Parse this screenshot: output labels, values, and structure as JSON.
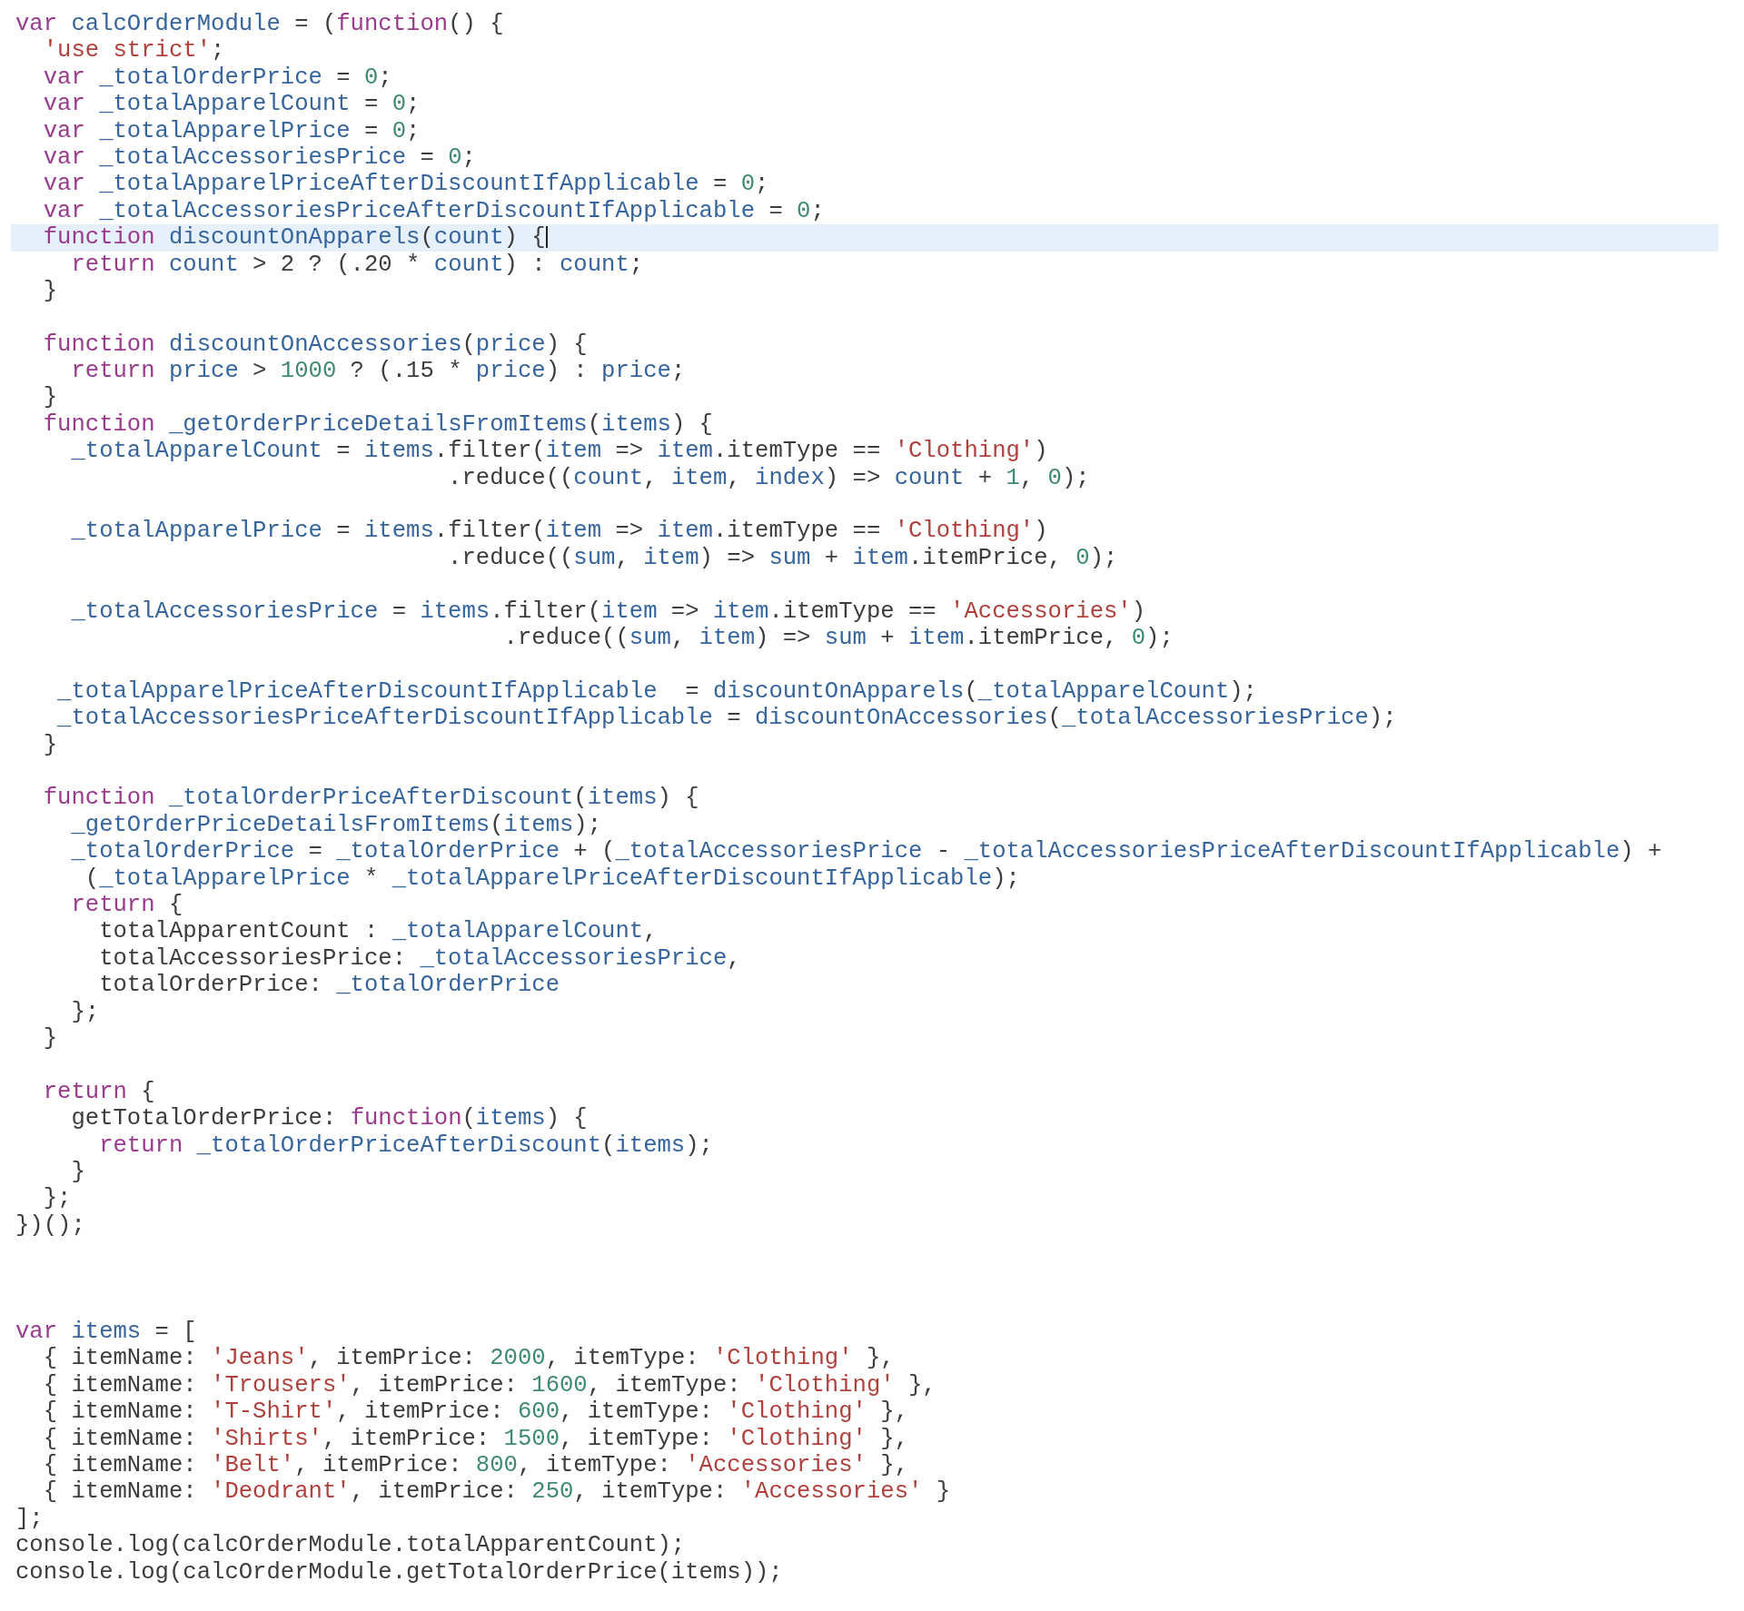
{
  "editor": {
    "module_lines": [
      {
        "current": false,
        "space_before": false,
        "tokens": [
          {
            "kind": "keyword",
            "text": "var"
          },
          {
            "kind": "name",
            "text": " calcOrderModule"
          },
          {
            "kind": "plain",
            "text": " = ("
          },
          {
            "kind": "keyword",
            "text": "function"
          },
          {
            "kind": "plain",
            "text": "() {"
          }
        ]
      },
      {
        "current": false,
        "space_before": false,
        "tokens": [
          {
            "kind": "string",
            "text": "  'use strict'"
          },
          {
            "kind": "plain",
            "text": ";"
          }
        ]
      },
      {
        "current": false,
        "space_before": false,
        "tokens": [
          {
            "kind": "keyword",
            "text": "  var"
          },
          {
            "kind": "name",
            "text": " _totalOrderPrice"
          },
          {
            "kind": "plain",
            "text": " = "
          },
          {
            "kind": "number",
            "text": "0"
          },
          {
            "kind": "plain",
            "text": ";"
          }
        ]
      },
      {
        "current": false,
        "space_before": false,
        "tokens": [
          {
            "kind": "keyword",
            "text": "  var"
          },
          {
            "kind": "name",
            "text": " _totalApparelCount"
          },
          {
            "kind": "plain",
            "text": " = "
          },
          {
            "kind": "number",
            "text": "0"
          },
          {
            "kind": "plain",
            "text": ";"
          }
        ]
      },
      {
        "current": false,
        "space_before": false,
        "tokens": [
          {
            "kind": "keyword",
            "text": "  var"
          },
          {
            "kind": "name",
            "text": " _totalApparelPrice"
          },
          {
            "kind": "plain",
            "text": " = "
          },
          {
            "kind": "number",
            "text": "0"
          },
          {
            "kind": "plain",
            "text": ";"
          }
        ]
      },
      {
        "current": false,
        "space_before": false,
        "tokens": [
          {
            "kind": "keyword",
            "text": "  var"
          },
          {
            "kind": "name",
            "text": " _totalAccessoriesPrice"
          },
          {
            "kind": "plain",
            "text": " = "
          },
          {
            "kind": "number",
            "text": "0"
          },
          {
            "kind": "plain",
            "text": ";"
          }
        ]
      },
      {
        "current": false,
        "space_before": false,
        "tokens": [
          {
            "kind": "keyword",
            "text": "  var"
          },
          {
            "kind": "name",
            "text": " _totalApparelPriceAfterDiscountIfApplicable"
          },
          {
            "kind": "plain",
            "text": " = "
          },
          {
            "kind": "number",
            "text": "0"
          },
          {
            "kind": "plain",
            "text": ";"
          }
        ]
      },
      {
        "current": false,
        "space_before": false,
        "tokens": [
          {
            "kind": "keyword",
            "text": "  var"
          },
          {
            "kind": "name",
            "text": " _totalAccessoriesPriceAfterDiscountIfApplicable"
          },
          {
            "kind": "plain",
            "text": " = "
          },
          {
            "kind": "number",
            "text": "0"
          },
          {
            "kind": "plain",
            "text": ";"
          }
        ]
      },
      {
        "current": true,
        "space_before": false,
        "tokens": [
          {
            "kind": "keyword",
            "text": "  function"
          },
          {
            "kind": "name",
            "text": " discountOnApparels"
          },
          {
            "kind": "plain",
            "text": "("
          },
          {
            "kind": "name",
            "text": "count"
          },
          {
            "kind": "plain",
            "text": ") {"
          }
        ]
      },
      {
        "current": false,
        "space_before": false,
        "tokens": [
          {
            "kind": "keyword",
            "text": "    return"
          },
          {
            "kind": "name",
            "text": " count"
          },
          {
            "kind": "plain",
            "text": " > 2 ? (.20 * "
          },
          {
            "kind": "name",
            "text": "count"
          },
          {
            "kind": "plain",
            "text": ") : "
          },
          {
            "kind": "name",
            "text": "count"
          },
          {
            "kind": "plain",
            "text": ";"
          }
        ]
      },
      {
        "current": false,
        "space_before": false,
        "tokens": [
          {
            "kind": "plain",
            "text": "  }"
          }
        ]
      },
      {
        "current": false,
        "space_before": true,
        "tokens": [
          {
            "kind": "keyword",
            "text": "  function"
          },
          {
            "kind": "name",
            "text": " discountOnAccessories"
          },
          {
            "kind": "plain",
            "text": "("
          },
          {
            "kind": "name",
            "text": "price"
          },
          {
            "kind": "plain",
            "text": ") {"
          }
        ]
      },
      {
        "current": false,
        "space_before": false,
        "tokens": [
          {
            "kind": "keyword",
            "text": "    return"
          },
          {
            "kind": "name",
            "text": " price"
          },
          {
            "kind": "plain",
            "text": " > "
          },
          {
            "kind": "number",
            "text": "1000"
          },
          {
            "kind": "plain",
            "text": " ? (.15 * "
          },
          {
            "kind": "name",
            "text": "price"
          },
          {
            "kind": "plain",
            "text": ") : "
          },
          {
            "kind": "name",
            "text": "price"
          },
          {
            "kind": "plain",
            "text": ";"
          }
        ]
      },
      {
        "current": false,
        "space_before": false,
        "tokens": [
          {
            "kind": "plain",
            "text": "  }"
          }
        ]
      },
      {
        "current": false,
        "space_before": false,
        "tokens": [
          {
            "kind": "keyword",
            "text": "  function"
          },
          {
            "kind": "name",
            "text": " _getOrderPriceDetailsFromItems"
          },
          {
            "kind": "plain",
            "text": "("
          },
          {
            "kind": "name",
            "text": "items"
          },
          {
            "kind": "plain",
            "text": ") {"
          }
        ]
      },
      {
        "current": false,
        "space_before": false,
        "tokens": [
          {
            "kind": "name",
            "text": "    _totalApparelCount"
          },
          {
            "kind": "plain",
            "text": " = "
          },
          {
            "kind": "name",
            "text": "items"
          },
          {
            "kind": "plain",
            "text": ".filter("
          },
          {
            "kind": "name",
            "text": "item"
          },
          {
            "kind": "plain",
            "text": " => "
          },
          {
            "kind": "name",
            "text": "item"
          },
          {
            "kind": "plain",
            "text": ".itemType == "
          },
          {
            "kind": "string",
            "text": "'Clothing'"
          },
          {
            "kind": "plain",
            "text": ")"
          }
        ]
      },
      {
        "current": false,
        "space_before": false,
        "tokens": [
          {
            "kind": "plain",
            "text": "                               .reduce(("
          },
          {
            "kind": "name",
            "text": "count"
          },
          {
            "kind": "plain",
            "text": ", "
          },
          {
            "kind": "name",
            "text": "item"
          },
          {
            "kind": "plain",
            "text": ", "
          },
          {
            "kind": "name",
            "text": "index"
          },
          {
            "kind": "plain",
            "text": ") => "
          },
          {
            "kind": "name",
            "text": "count"
          },
          {
            "kind": "plain",
            "text": " + "
          },
          {
            "kind": "number",
            "text": "1"
          },
          {
            "kind": "plain",
            "text": ", "
          },
          {
            "kind": "number",
            "text": "0"
          },
          {
            "kind": "plain",
            "text": ");"
          }
        ]
      },
      {
        "current": false,
        "space_before": true,
        "tokens": [
          {
            "kind": "name",
            "text": "    _totalApparelPrice"
          },
          {
            "kind": "plain",
            "text": " = "
          },
          {
            "kind": "name",
            "text": "items"
          },
          {
            "kind": "plain",
            "text": ".filter("
          },
          {
            "kind": "name",
            "text": "item"
          },
          {
            "kind": "plain",
            "text": " => "
          },
          {
            "kind": "name",
            "text": "item"
          },
          {
            "kind": "plain",
            "text": ".itemType == "
          },
          {
            "kind": "string",
            "text": "'Clothing'"
          },
          {
            "kind": "plain",
            "text": ")"
          }
        ]
      },
      {
        "current": false,
        "space_before": false,
        "tokens": [
          {
            "kind": "plain",
            "text": "                               .reduce(("
          },
          {
            "kind": "name",
            "text": "sum"
          },
          {
            "kind": "plain",
            "text": ", "
          },
          {
            "kind": "name",
            "text": "item"
          },
          {
            "kind": "plain",
            "text": ") => "
          },
          {
            "kind": "name",
            "text": "sum"
          },
          {
            "kind": "plain",
            "text": " + "
          },
          {
            "kind": "name",
            "text": "item"
          },
          {
            "kind": "plain",
            "text": ".itemPrice, "
          },
          {
            "kind": "number",
            "text": "0"
          },
          {
            "kind": "plain",
            "text": ");"
          }
        ]
      },
      {
        "current": false,
        "space_before": true,
        "tokens": [
          {
            "kind": "name",
            "text": "    _totalAccessoriesPrice"
          },
          {
            "kind": "plain",
            "text": " = "
          },
          {
            "kind": "name",
            "text": "items"
          },
          {
            "kind": "plain",
            "text": ".filter("
          },
          {
            "kind": "name",
            "text": "item"
          },
          {
            "kind": "plain",
            "text": " => "
          },
          {
            "kind": "name",
            "text": "item"
          },
          {
            "kind": "plain",
            "text": ".itemType == "
          },
          {
            "kind": "string",
            "text": "'Accessories'"
          },
          {
            "kind": "plain",
            "text": ")"
          }
        ]
      },
      {
        "current": false,
        "space_before": false,
        "tokens": [
          {
            "kind": "plain",
            "text": "                                   .reduce(("
          },
          {
            "kind": "name",
            "text": "sum"
          },
          {
            "kind": "plain",
            "text": ", "
          },
          {
            "kind": "name",
            "text": "item"
          },
          {
            "kind": "plain",
            "text": ") => "
          },
          {
            "kind": "name",
            "text": "sum"
          },
          {
            "kind": "plain",
            "text": " + "
          },
          {
            "kind": "name",
            "text": "item"
          },
          {
            "kind": "plain",
            "text": ".itemPrice, "
          },
          {
            "kind": "number",
            "text": "0"
          },
          {
            "kind": "plain",
            "text": ");"
          }
        ]
      },
      {
        "current": false,
        "space_before": true,
        "tokens": [
          {
            "kind": "name",
            "text": "   _totalApparelPriceAfterDiscountIfApplicable"
          },
          {
            "kind": "plain",
            "text": "  = "
          },
          {
            "kind": "name",
            "text": "discountOnApparels"
          },
          {
            "kind": "plain",
            "text": "("
          },
          {
            "kind": "name",
            "text": "_totalApparelCount"
          },
          {
            "kind": "plain",
            "text": ");"
          }
        ]
      },
      {
        "current": false,
        "space_before": false,
        "tokens": [
          {
            "kind": "name",
            "text": "   _totalAccessoriesPriceAfterDiscountIfApplicable"
          },
          {
            "kind": "plain",
            "text": " = "
          },
          {
            "kind": "name",
            "text": "discountOnAccessories"
          },
          {
            "kind": "plain",
            "text": "("
          },
          {
            "kind": "name",
            "text": "_totalAccessoriesPrice"
          },
          {
            "kind": "plain",
            "text": ");"
          }
        ]
      },
      {
        "current": false,
        "space_before": false,
        "tokens": [
          {
            "kind": "plain",
            "text": "  }"
          }
        ]
      },
      {
        "current": false,
        "space_before": true,
        "tokens": [
          {
            "kind": "keyword",
            "text": "  function"
          },
          {
            "kind": "name",
            "text": " _totalOrderPriceAfterDiscount"
          },
          {
            "kind": "plain",
            "text": "("
          },
          {
            "kind": "name",
            "text": "items"
          },
          {
            "kind": "plain",
            "text": ") {"
          }
        ]
      },
      {
        "current": false,
        "space_before": false,
        "tokens": [
          {
            "kind": "name",
            "text": "    _getOrderPriceDetailsFromItems"
          },
          {
            "kind": "plain",
            "text": "("
          },
          {
            "kind": "name",
            "text": "items"
          },
          {
            "kind": "plain",
            "text": ");"
          }
        ]
      },
      {
        "current": false,
        "space_before": false,
        "tokens": [
          {
            "kind": "name",
            "text": "    _totalOrderPrice"
          },
          {
            "kind": "plain",
            "text": " = "
          },
          {
            "kind": "name",
            "text": "_totalOrderPrice"
          },
          {
            "kind": "plain",
            "text": " + ("
          },
          {
            "kind": "name",
            "text": "_totalAccessoriesPrice"
          },
          {
            "kind": "plain",
            "text": " - "
          },
          {
            "kind": "name",
            "text": "_totalAccessoriesPriceAfterDiscountIfApplicable"
          },
          {
            "kind": "plain",
            "text": ") +"
          }
        ]
      },
      {
        "current": false,
        "space_before": false,
        "tokens": [
          {
            "kind": "plain",
            "text": "     ("
          },
          {
            "kind": "name",
            "text": "_totalApparelPrice"
          },
          {
            "kind": "plain",
            "text": " * "
          },
          {
            "kind": "name",
            "text": "_totalApparelPriceAfterDiscountIfApplicable"
          },
          {
            "kind": "plain",
            "text": ");"
          }
        ]
      },
      {
        "current": false,
        "space_before": false,
        "tokens": [
          {
            "kind": "keyword",
            "text": "    return"
          },
          {
            "kind": "plain",
            "text": " {"
          }
        ]
      },
      {
        "current": false,
        "space_before": false,
        "tokens": [
          {
            "kind": "plain",
            "text": "      totalApparentCount : "
          },
          {
            "kind": "name",
            "text": "_totalApparelCount"
          },
          {
            "kind": "plain",
            "text": ","
          }
        ]
      },
      {
        "current": false,
        "space_before": false,
        "tokens": [
          {
            "kind": "plain",
            "text": "      totalAccessoriesPrice: "
          },
          {
            "kind": "name",
            "text": "_totalAccessoriesPrice"
          },
          {
            "kind": "plain",
            "text": ","
          }
        ]
      },
      {
        "current": false,
        "space_before": false,
        "tokens": [
          {
            "kind": "plain",
            "text": "      totalOrderPrice: "
          },
          {
            "kind": "name",
            "text": "_totalOrderPrice"
          }
        ]
      },
      {
        "current": false,
        "space_before": false,
        "tokens": [
          {
            "kind": "plain",
            "text": "    };"
          }
        ]
      },
      {
        "current": false,
        "space_before": false,
        "tokens": [
          {
            "kind": "plain",
            "text": "  }"
          }
        ]
      },
      {
        "current": false,
        "space_before": true,
        "tokens": [
          {
            "kind": "keyword",
            "text": "  return"
          },
          {
            "kind": "plain",
            "text": " {"
          }
        ]
      },
      {
        "current": false,
        "space_before": false,
        "tokens": [
          {
            "kind": "plain",
            "text": "    getTotalOrderPrice: "
          },
          {
            "kind": "keyword",
            "text": "function"
          },
          {
            "kind": "plain",
            "text": "("
          },
          {
            "kind": "name",
            "text": "items"
          },
          {
            "kind": "plain",
            "text": ") {"
          }
        ]
      },
      {
        "current": false,
        "space_before": false,
        "tokens": [
          {
            "kind": "keyword",
            "text": "      return"
          },
          {
            "kind": "name",
            "text": " _totalOrderPriceAfterDiscount"
          },
          {
            "kind": "plain",
            "text": "("
          },
          {
            "kind": "name",
            "text": "items"
          },
          {
            "kind": "plain",
            "text": ");"
          }
        ]
      },
      {
        "current": false,
        "space_before": false,
        "tokens": [
          {
            "kind": "plain",
            "text": "    }"
          }
        ]
      },
      {
        "current": false,
        "space_before": false,
        "tokens": [
          {
            "kind": "plain",
            "text": "  };"
          }
        ]
      },
      {
        "current": false,
        "space_before": false,
        "tokens": [
          {
            "kind": "plain",
            "text": "})();"
          }
        ]
      }
    ],
    "script_lines": [
      {
        "current": false,
        "space_before": false,
        "tokens": [
          {
            "kind": "keyword",
            "text": "var"
          },
          {
            "kind": "name",
            "text": " items"
          },
          {
            "kind": "plain",
            "text": " = ["
          }
        ]
      },
      {
        "current": false,
        "space_before": false,
        "tokens": [
          {
            "kind": "plain",
            "text": "  { itemName: "
          },
          {
            "kind": "string",
            "text": "'Jeans'"
          },
          {
            "kind": "plain",
            "text": ", itemPrice: "
          },
          {
            "kind": "number",
            "text": "2000"
          },
          {
            "kind": "plain",
            "text": ", itemType: "
          },
          {
            "kind": "string",
            "text": "'Clothing'"
          },
          {
            "kind": "plain",
            "text": " },"
          }
        ]
      },
      {
        "current": false,
        "space_before": false,
        "tokens": [
          {
            "kind": "plain",
            "text": "  { itemName: "
          },
          {
            "kind": "string",
            "text": "'Trousers'"
          },
          {
            "kind": "plain",
            "text": ", itemPrice: "
          },
          {
            "kind": "number",
            "text": "1600"
          },
          {
            "kind": "plain",
            "text": ", itemType: "
          },
          {
            "kind": "string",
            "text": "'Clothing'"
          },
          {
            "kind": "plain",
            "text": " },"
          }
        ]
      },
      {
        "current": false,
        "space_before": false,
        "tokens": [
          {
            "kind": "plain",
            "text": "  { itemName: "
          },
          {
            "kind": "string",
            "text": "'T-Shirt'"
          },
          {
            "kind": "plain",
            "text": ", itemPrice: "
          },
          {
            "kind": "number",
            "text": "600"
          },
          {
            "kind": "plain",
            "text": ", itemType: "
          },
          {
            "kind": "string",
            "text": "'Clothing'"
          },
          {
            "kind": "plain",
            "text": " },"
          }
        ]
      },
      {
        "current": false,
        "space_before": false,
        "tokens": [
          {
            "kind": "plain",
            "text": "  { itemName: "
          },
          {
            "kind": "string",
            "text": "'Shirts'"
          },
          {
            "kind": "plain",
            "text": ", itemPrice: "
          },
          {
            "kind": "number",
            "text": "1500"
          },
          {
            "kind": "plain",
            "text": ", itemType: "
          },
          {
            "kind": "string",
            "text": "'Clothing'"
          },
          {
            "kind": "plain",
            "text": " },"
          }
        ]
      },
      {
        "current": false,
        "space_before": false,
        "tokens": [
          {
            "kind": "plain",
            "text": "  { itemName: "
          },
          {
            "kind": "string",
            "text": "'Belt'"
          },
          {
            "kind": "plain",
            "text": ", itemPrice: "
          },
          {
            "kind": "number",
            "text": "800"
          },
          {
            "kind": "plain",
            "text": ", itemType: "
          },
          {
            "kind": "string",
            "text": "'Accessories'"
          },
          {
            "kind": "plain",
            "text": " },"
          }
        ]
      },
      {
        "current": false,
        "space_before": false,
        "tokens": [
          {
            "kind": "plain",
            "text": "  { itemName: "
          },
          {
            "kind": "string",
            "text": "'Deodrant'"
          },
          {
            "kind": "plain",
            "text": ", itemPrice: "
          },
          {
            "kind": "number",
            "text": "250"
          },
          {
            "kind": "plain",
            "text": ", itemType: "
          },
          {
            "kind": "string",
            "text": "'Accessories'"
          },
          {
            "kind": "plain",
            "text": " }"
          }
        ]
      },
      {
        "current": false,
        "space_before": false,
        "tokens": [
          {
            "kind": "plain",
            "text": "];"
          }
        ]
      },
      {
        "current": false,
        "space_before": false,
        "tokens": [
          {
            "kind": "plain",
            "text": "console.log(calcOrderModule.totalApparentCount);"
          }
        ]
      },
      {
        "current": false,
        "space_before": false,
        "tokens": [
          {
            "kind": "plain",
            "text": "console.log(calcOrderModule.getTotalOrderPrice(items));"
          }
        ]
      }
    ]
  }
}
